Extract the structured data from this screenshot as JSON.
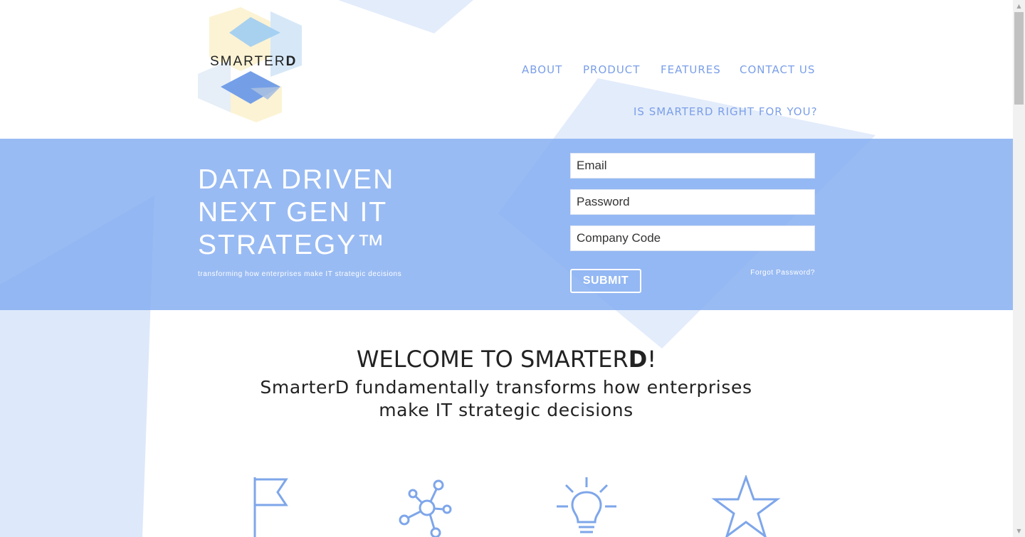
{
  "brand": {
    "logo_prefix": "SMARTER",
    "logo_suffix": "D"
  },
  "nav": {
    "items": [
      {
        "label": "ABOUT"
      },
      {
        "label": "PRODUCT"
      },
      {
        "label": "FEATURES"
      },
      {
        "label": "CONTACT US"
      },
      {
        "label": "IS SMARTERD RIGHT FOR YOU?"
      }
    ]
  },
  "hero": {
    "title_lines": [
      "DATA DRIVEN",
      "NEXT GEN IT",
      "STRATEGY™"
    ],
    "tagline": "transforming how enterprises make IT strategic decisions"
  },
  "login": {
    "email_placeholder": "Email",
    "password_placeholder": "Password",
    "company_code_placeholder": "Company Code",
    "submit_label": "SUBMIT",
    "forgot_label": "Forgot Password?"
  },
  "welcome": {
    "title_prefix": "WELCOME TO SMARTER",
    "title_bold": "D",
    "title_suffix": "!",
    "subtitle_lines": [
      "SmarterD fundamentally transforms how enterprises",
      "make IT strategic decisions"
    ]
  },
  "features": {
    "icons": [
      "flag-icon",
      "network-icon",
      "lightbulb-icon",
      "star-icon"
    ]
  },
  "colors": {
    "accent": "#7b9fe8",
    "hero_bg": "#8eb3f1",
    "icon_stroke": "#7ea6ea",
    "text_dark": "#222222"
  }
}
